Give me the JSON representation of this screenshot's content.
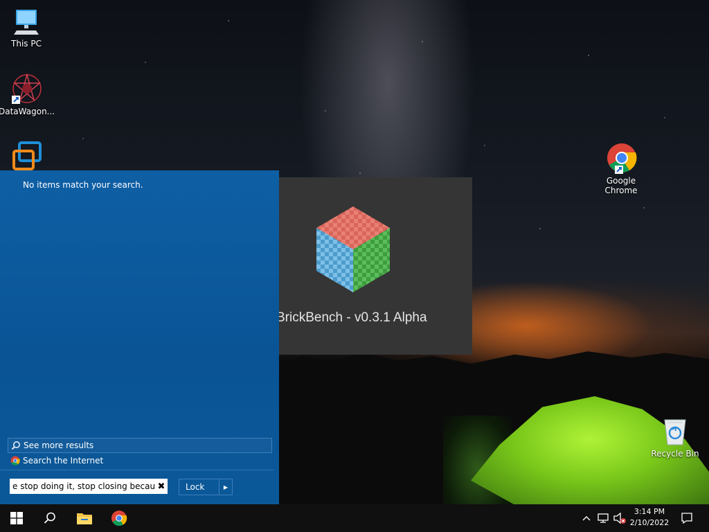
{
  "desktop": {
    "icons": [
      {
        "label": "This PC",
        "icon": "this-pc-icon"
      },
      {
        "label": "DataWagon...",
        "icon": "datawagon-icon"
      },
      {
        "label": "",
        "icon": "app-window-icon"
      },
      {
        "label": "Google\nChrome",
        "icon": "chrome-icon"
      },
      {
        "label": "Recycle Bin",
        "icon": "recycle-bin-icon"
      }
    ]
  },
  "splash": {
    "title": "BrickBench - v0.3.1 Alpha",
    "colors": {
      "top": "#d9655a",
      "left": "#5aa8d6",
      "right": "#4caa4c",
      "background": "#353535"
    }
  },
  "start_menu": {
    "no_match_text": "No items match your search.",
    "see_more_label": "See more results",
    "search_internet_label": "Search the Internet",
    "search_value": "e stop doing it, stop closing because",
    "clear_glyph": "✖",
    "lock_label": "Lock",
    "lock_arrow": "▶",
    "accent": "#0b5898"
  },
  "taskbar": {
    "items": [
      "start-button",
      "search-button",
      "file-explorer",
      "chrome"
    ],
    "tray_icons": [
      "show-hidden-icons",
      "network-icon",
      "volume-muted-icon"
    ],
    "time": "3:14 PM",
    "date": "2/10/2022"
  }
}
